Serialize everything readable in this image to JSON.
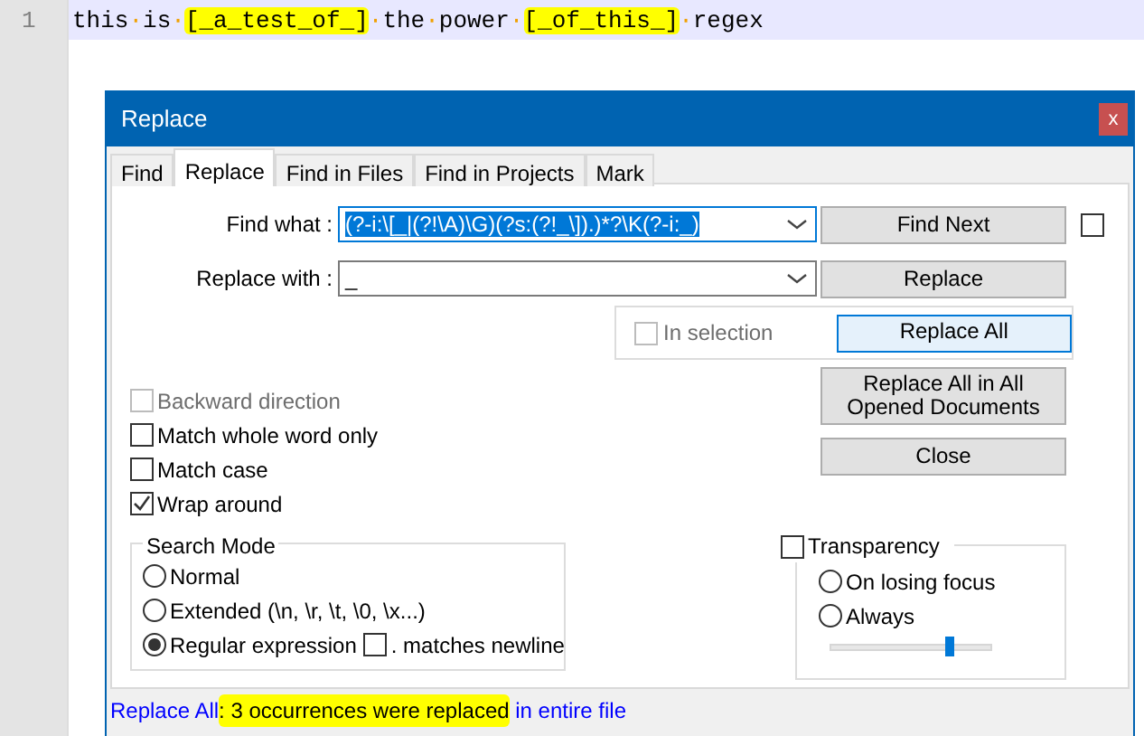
{
  "editor": {
    "line_number": "1",
    "segments": [
      {
        "text": "this",
        "kind": "word",
        "highlighted": false
      },
      {
        "text": "·",
        "kind": "space",
        "highlighted": false
      },
      {
        "text": "is",
        "kind": "word",
        "highlighted": false
      },
      {
        "text": "·",
        "kind": "space",
        "highlighted": false
      },
      {
        "text": "[_a_test_of_]",
        "kind": "word",
        "highlighted": true
      },
      {
        "text": "·",
        "kind": "space",
        "highlighted": false
      },
      {
        "text": "the",
        "kind": "word",
        "highlighted": false
      },
      {
        "text": "·",
        "kind": "space",
        "highlighted": false
      },
      {
        "text": "power",
        "kind": "word",
        "highlighted": false
      },
      {
        "text": "·",
        "kind": "space",
        "highlighted": false
      },
      {
        "text": "[_of_this_]",
        "kind": "word",
        "highlighted": true
      },
      {
        "text": "·",
        "kind": "space",
        "highlighted": false
      },
      {
        "text": "regex",
        "kind": "word",
        "highlighted": false
      }
    ]
  },
  "dialog": {
    "title": "Replace",
    "close": "x",
    "tabs": [
      {
        "label": "Find",
        "selected": false
      },
      {
        "label": "Replace",
        "selected": true
      },
      {
        "label": "Find in Files",
        "selected": false
      },
      {
        "label": "Find in Projects",
        "selected": false
      },
      {
        "label": "Mark",
        "selected": false
      }
    ],
    "fields": [
      {
        "label": "Find what :",
        "value": "(?-i:\\[_|(?!\\A)\\G)(?s:(?!_\\]).)*?\\K(?-i:_)",
        "selected": true
      },
      {
        "label": "Replace with :",
        "value": "_",
        "selected": false
      }
    ],
    "find_next_checkbox": {
      "checked": false
    },
    "in_selection": {
      "label": "In selection",
      "checked": false,
      "disabled": true
    },
    "buttons": [
      {
        "label": "Find Next",
        "focused": false
      },
      {
        "label": "Replace",
        "focused": false
      },
      {
        "label": "Replace All",
        "focused": true
      },
      {
        "label": "Replace All in All Opened Documents",
        "focused": false
      },
      {
        "label": "Close",
        "focused": false
      }
    ],
    "options": [
      {
        "label": "Backward direction",
        "checked": false,
        "disabled": true
      },
      {
        "label": "Match whole word only",
        "checked": false,
        "disabled": false
      },
      {
        "label": "Match case",
        "checked": false,
        "disabled": false
      },
      {
        "label": "Wrap around",
        "checked": true,
        "disabled": false
      }
    ],
    "search_mode": {
      "title": "Search Mode",
      "modes": [
        {
          "label": "Normal",
          "selected": false
        },
        {
          "label": "Extended (\\n, \\r, \\t, \\0, \\x...)",
          "selected": false
        },
        {
          "label": "Regular expression",
          "selected": true
        }
      ],
      "dot_newline": {
        "label": ". matches newline",
        "checked": false
      }
    },
    "transparency": {
      "label": "Transparency",
      "checked": false,
      "modes": [
        {
          "label": "On losing focus",
          "selected": false
        },
        {
          "label": "Always",
          "selected": false
        }
      ],
      "level": 0.72
    },
    "status": [
      {
        "text": "Replace All",
        "highlighted": false
      },
      {
        "text": ": 3 occurrences were replaced",
        "highlighted": true
      },
      {
        "text": " in entire file",
        "highlighted": false
      }
    ]
  }
}
